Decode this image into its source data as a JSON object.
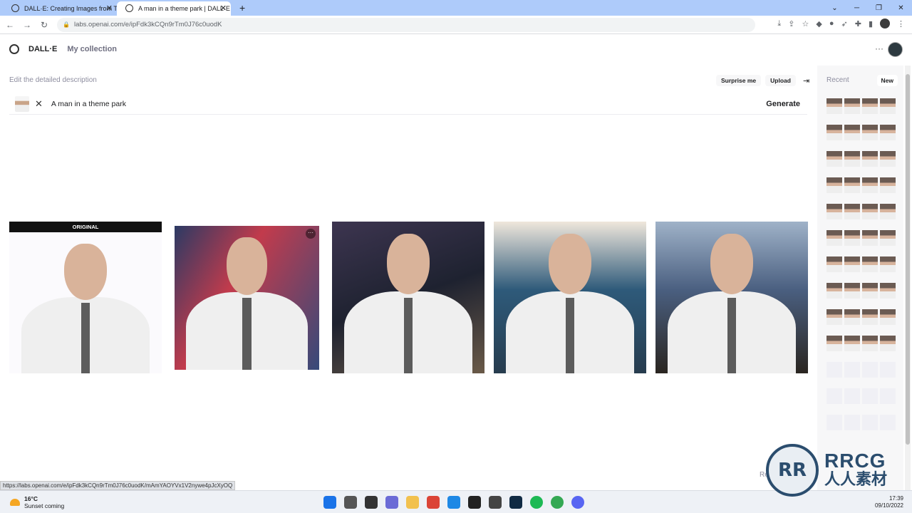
{
  "browser": {
    "tabs": [
      {
        "title": "DALL·E: Creating Images from Te",
        "active": false
      },
      {
        "title": "A man in a theme park | DALL·E",
        "active": true
      }
    ],
    "url": "labs.openai.com/e/ipFdk3kCQn9rTm0J76c0uodK",
    "status_url": "https://labs.openai.com/e/ipFdk3kCQn9rTm0J76c0uodK/mAmYAOYVx1V2nywe4pJcXyOQ"
  },
  "app": {
    "brand": "DALL·E",
    "nav_collection": "My collection"
  },
  "editor": {
    "edit_label": "Edit the detailed description",
    "surprise_label": "Surprise me",
    "upload_label": "Upload",
    "prompt_text": "A man in a theme park",
    "generate_label": "Generate"
  },
  "results": {
    "original_label": "ORIGINAL"
  },
  "sidebar": {
    "recent_label": "Recent",
    "new_label": "New",
    "partial_text": "Re"
  },
  "taskbar": {
    "temperature": "16°C",
    "weather_text": "Sunset coming",
    "time": "17:39",
    "date": "09/10/2022"
  },
  "watermark": {
    "logo_text": "RR",
    "text_en": "RRCG",
    "text_cn": "人人素材"
  }
}
